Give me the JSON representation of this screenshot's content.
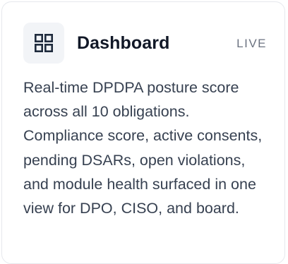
{
  "card": {
    "icon": "dashboard-grid-icon",
    "title": "Dashboard",
    "badge": "LIVE",
    "description": "Real-time DPDPA posture score across all 10 obligations. Compliance score, active consents, pending DSARs, open violations, and module health surfaced in one view for DPO, CISO, and board."
  },
  "colors": {
    "title": "#111827",
    "text": "#374151",
    "badge": "#6b7280",
    "icon": "#1f2b3d",
    "icon_bg": "#f2f4f7",
    "border": "#e6e8ed"
  }
}
